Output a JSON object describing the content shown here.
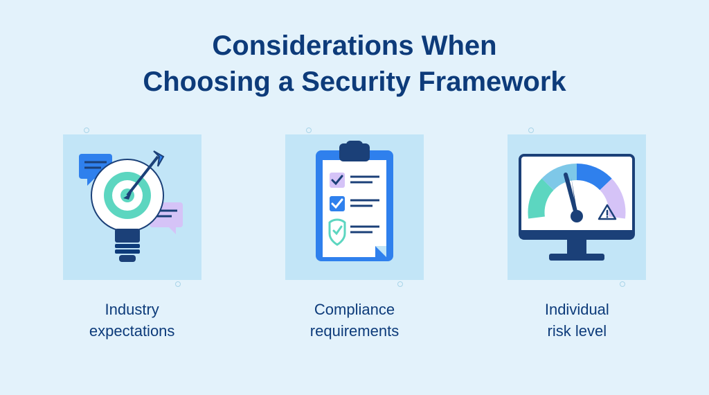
{
  "title": "Considerations When\nChoosing a Security Framework",
  "cards": [
    {
      "caption": "Industry\nexpectations",
      "icon": "lightbulb-target-icon"
    },
    {
      "caption": "Compliance\nrequirements",
      "icon": "clipboard-checklist-icon"
    },
    {
      "caption": "Individual\nrisk level",
      "icon": "monitor-gauge-icon"
    }
  ],
  "colors": {
    "background": "#e3f2fb",
    "tile": "#c2e5f7",
    "primary": "#0d3b7a",
    "accent_blue": "#2f80ed",
    "accent_teal": "#5cd6c0",
    "accent_lilac": "#d5c3f7",
    "dark_navy": "#1b4078"
  }
}
